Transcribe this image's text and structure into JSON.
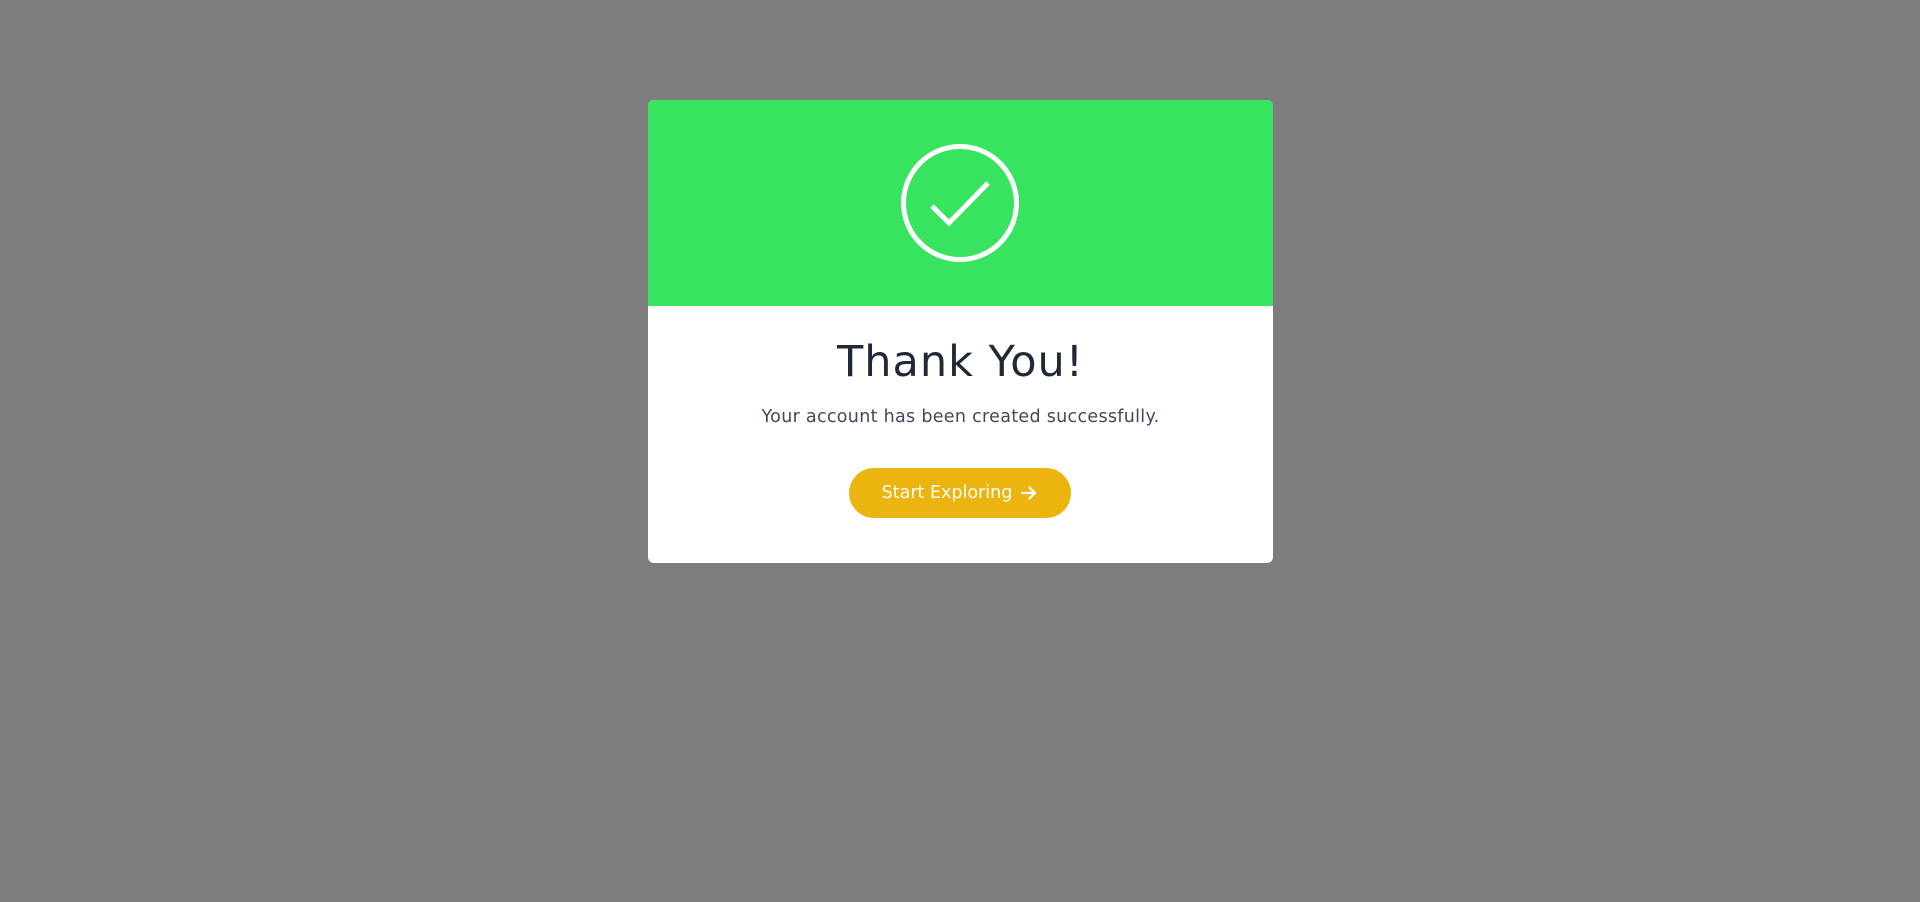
{
  "colors": {
    "backdrop": "#7d7d7d",
    "header": "#38e360",
    "card": "#ffffff",
    "button": "#ecb40f",
    "title": "#1f2937",
    "message": "#3f4a5a"
  },
  "modal": {
    "icon": "check-circle-icon",
    "title": "Thank You!",
    "message": "Your account has been created successfully.",
    "button": {
      "label": "Start Exploring",
      "icon": "arrow-right-icon"
    }
  }
}
